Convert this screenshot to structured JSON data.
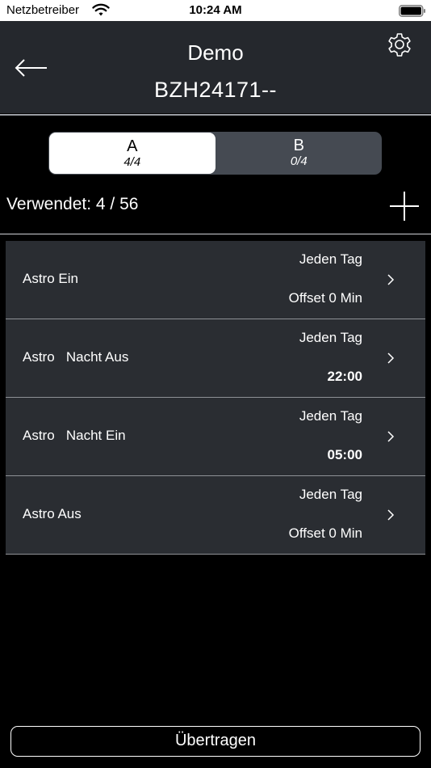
{
  "status_bar": {
    "carrier": "Netzbetreiber",
    "time": "10:24 AM",
    "wifi_icon": "wifi-icon",
    "battery_icon": "battery-icon"
  },
  "header": {
    "title": "Demo",
    "subtitle": "BZH24171--",
    "back_icon": "arrow-left-icon",
    "settings_icon": "gear-icon",
    "background": "#25282d"
  },
  "segments": [
    {
      "label": "A",
      "count": "4/4",
      "active": true
    },
    {
      "label": "B",
      "count": "0/4",
      "active": false
    }
  ],
  "usage": {
    "text": "Verwendet:  4 / 56",
    "add_icon": "plus-icon"
  },
  "items": [
    {
      "name": "Astro Ein",
      "repeat": "Jeden Tag",
      "time": "Offset 0 Min"
    },
    {
      "name": "Astro   Nacht Aus",
      "repeat": "Jeden Tag",
      "time": "22:00"
    },
    {
      "name": "Astro   Nacht Ein",
      "repeat": "Jeden Tag",
      "time": "05:00"
    },
    {
      "name": "Astro Aus",
      "repeat": "Jeden Tag",
      "time": "Offset 0 Min"
    }
  ],
  "transfer_button": {
    "label": "Übertragen"
  },
  "colors": {
    "background": "#000000",
    "list_item": "#2a2d32",
    "segment_inactive": "#454a52"
  }
}
